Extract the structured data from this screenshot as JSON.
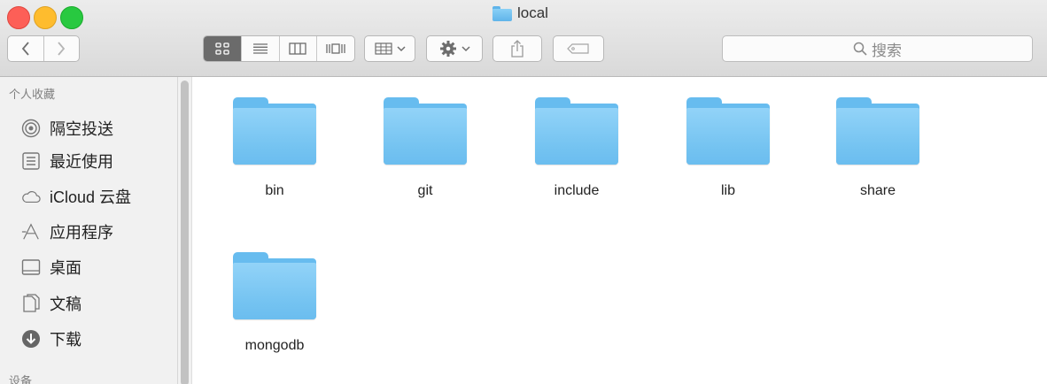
{
  "window": {
    "title": "local"
  },
  "toolbar": {
    "back_icon": "chevron-left-icon",
    "forward_icon": "chevron-right-icon",
    "view_icons": [
      "icon-view-icon",
      "list-view-icon",
      "column-view-icon",
      "cover-flow-view-icon"
    ],
    "active_view": "icon-view",
    "arrange_icon": "arrange-grid-icon",
    "action_icon": "gear-icon",
    "share_icon": "share-icon",
    "tag_icon": "tag-icon",
    "search_placeholder": "搜索"
  },
  "sidebar": {
    "favorites_title": "个人收藏",
    "items": [
      {
        "label": "隔空投送",
        "icon": "airdrop-icon"
      },
      {
        "label": "最近使用",
        "icon": "recents-icon"
      },
      {
        "label": "iCloud 云盘",
        "icon": "icloud-icon"
      },
      {
        "label": "应用程序",
        "icon": "applications-icon"
      },
      {
        "label": "桌面",
        "icon": "desktop-icon"
      },
      {
        "label": "文稿",
        "icon": "documents-icon"
      },
      {
        "label": "下载",
        "icon": "downloads-icon"
      }
    ],
    "devices_title": "设备"
  },
  "files": [
    {
      "name": "bin"
    },
    {
      "name": "git"
    },
    {
      "name": "include"
    },
    {
      "name": "lib"
    },
    {
      "name": "share"
    },
    {
      "name": "mongodb"
    }
  ],
  "colors": {
    "folder": "#74c3f1",
    "close": "#fd5f57",
    "minimize": "#febc2e",
    "zoom": "#28c940"
  }
}
